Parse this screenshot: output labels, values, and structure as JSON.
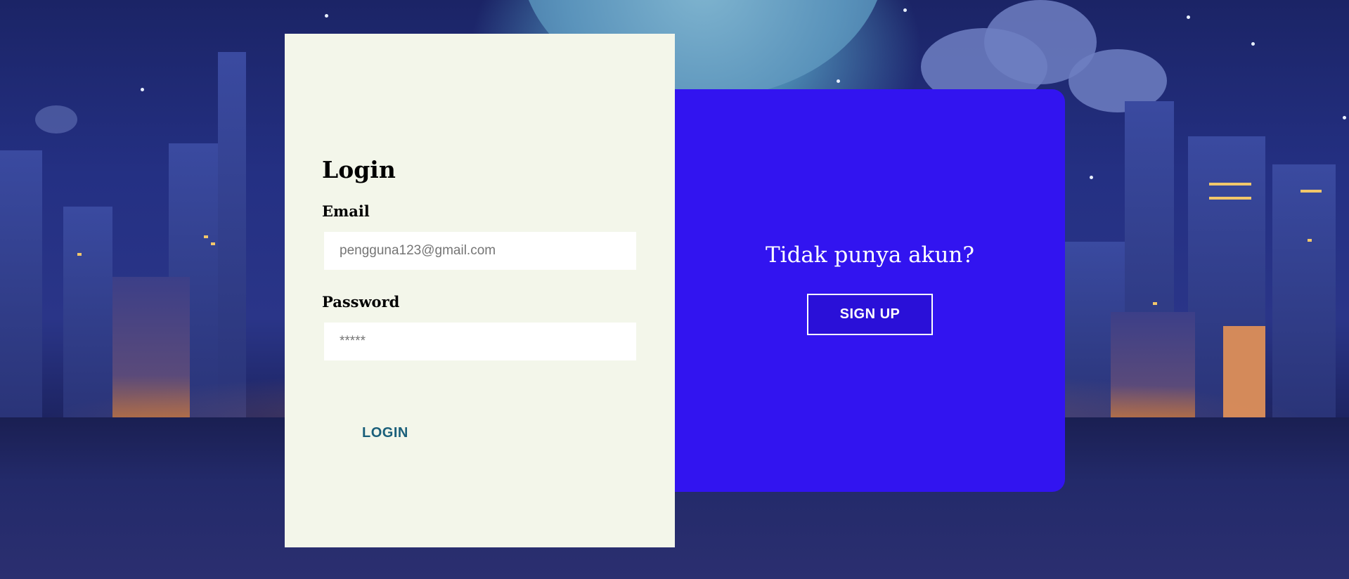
{
  "login": {
    "title": "Login",
    "email_label": "Email",
    "email_placeholder": "pengguna123@gmail.com",
    "password_label": "Password",
    "password_placeholder": "*****",
    "submit_label": "LOGIN"
  },
  "signup": {
    "prompt": "Tidak punya akun?",
    "button_label": "SIGN UP"
  },
  "colors": {
    "login_panel_bg": "#f3f6ea",
    "signup_panel_bg": "#3214f0",
    "login_button_text": "#1a5f7a"
  }
}
